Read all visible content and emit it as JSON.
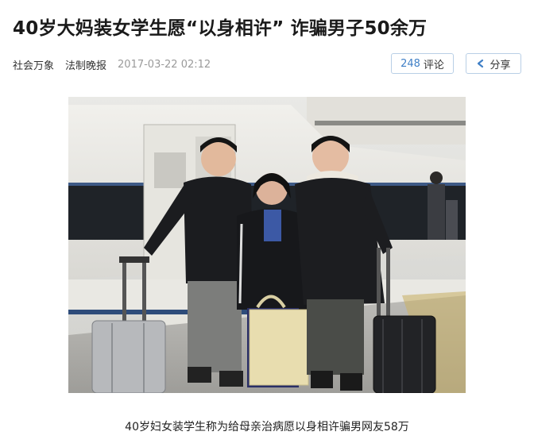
{
  "article": {
    "title": "40岁大妈装女学生愿“以身相许” 诈骗男子50余万",
    "sources": [
      "社会万象",
      "法制晚报"
    ],
    "time": "2017-03-22 02:12"
  },
  "actions": {
    "comment_count": "248",
    "comment_label": "评论",
    "share_label": "分享"
  },
  "photo": {
    "caption": "40岁妇女装学生称为给母亲治病愿以身相许骗男网友58万"
  }
}
